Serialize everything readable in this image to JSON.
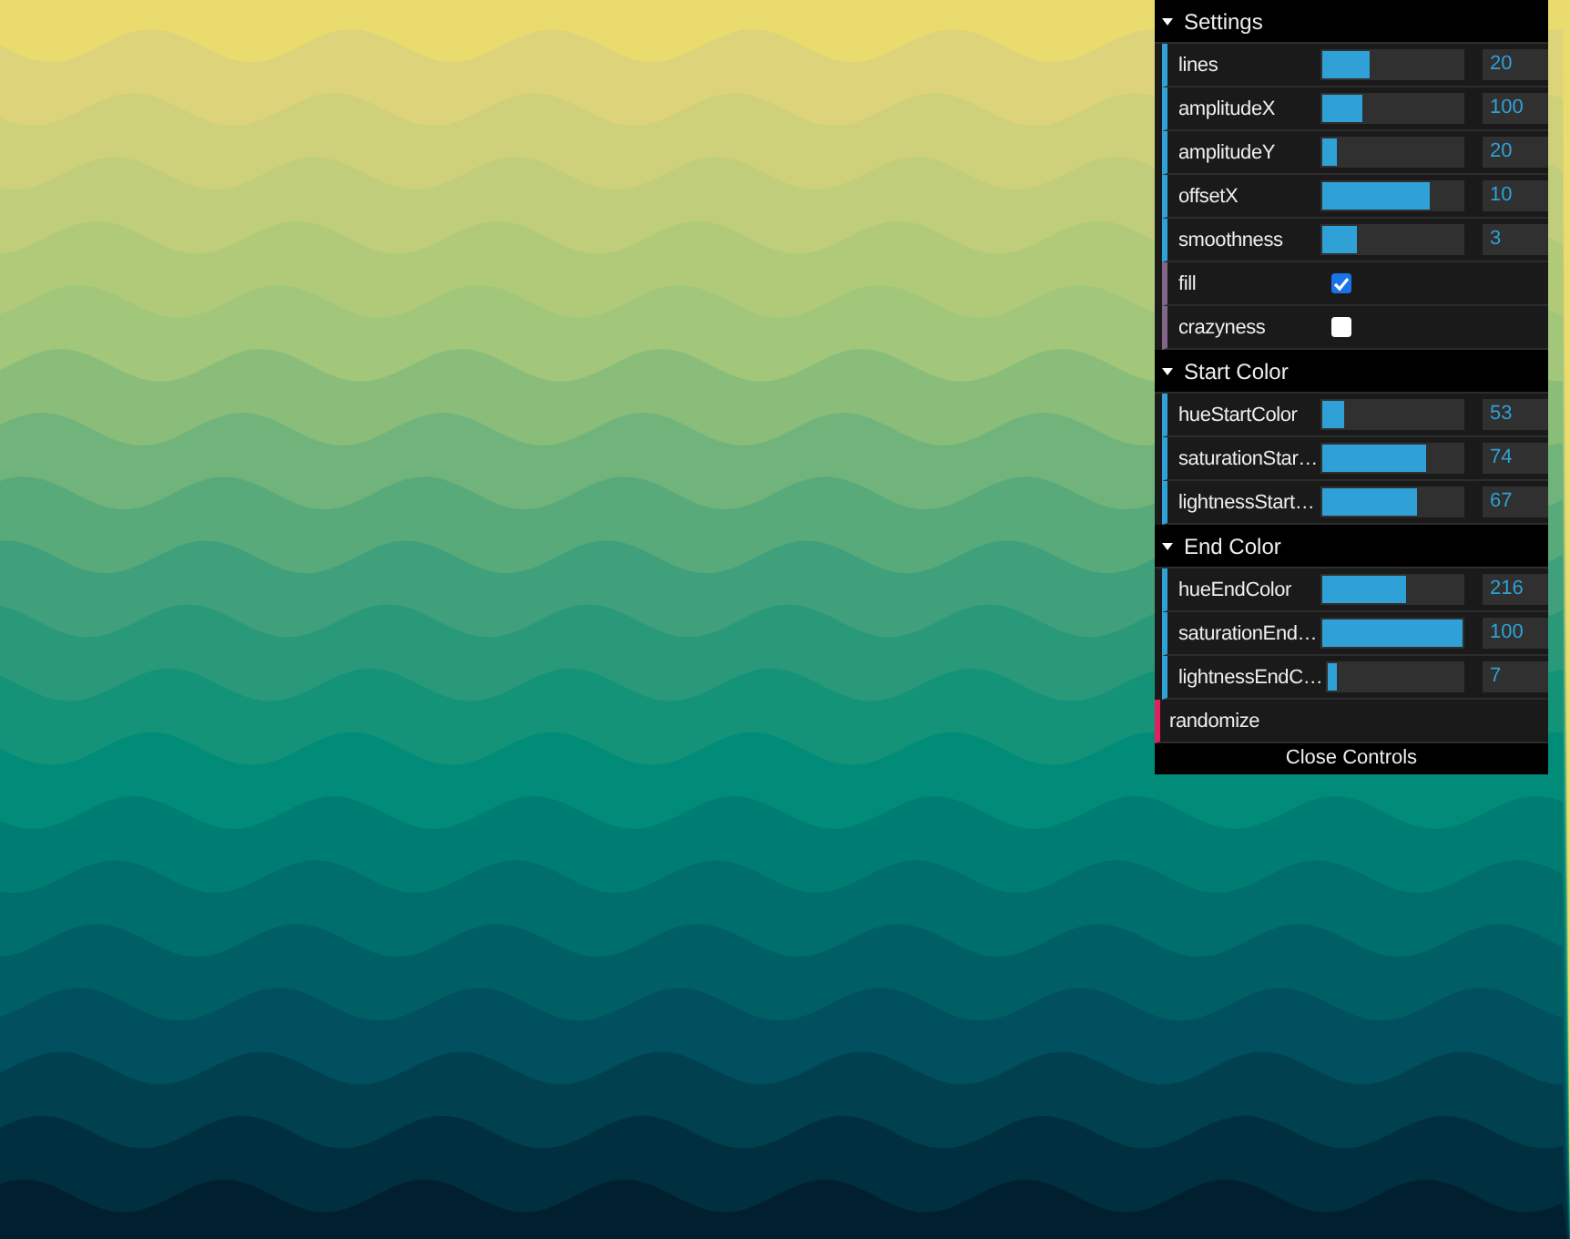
{
  "folders": [
    {
      "title": "Settings",
      "expanded": true,
      "controls": [
        {
          "kind": "number",
          "label": "lines",
          "level": 0.34,
          "value": "20"
        },
        {
          "kind": "number",
          "label": "amplitudeX",
          "level": 0.29,
          "value": "100"
        },
        {
          "kind": "number",
          "label": "amplitudeY",
          "level": 0.1,
          "value": "20"
        },
        {
          "kind": "number",
          "label": "offsetX",
          "level": 0.76,
          "value": "10"
        },
        {
          "kind": "number",
          "label": "smoothness",
          "level": 0.25,
          "value": "3"
        },
        {
          "kind": "boolean",
          "label": "fill",
          "checked": true
        },
        {
          "kind": "boolean",
          "label": "crazyness",
          "checked": false
        }
      ]
    },
    {
      "title": "Start Color",
      "expanded": true,
      "controls": [
        {
          "kind": "number",
          "label": "hueStartColor",
          "level": 0.15,
          "value": "53"
        },
        {
          "kind": "number",
          "label": "saturationStar…",
          "level": 0.74,
          "value": "74"
        },
        {
          "kind": "number",
          "label": "lightnessStart…",
          "level": 0.67,
          "value": "67"
        }
      ]
    },
    {
      "title": "End Color",
      "expanded": true,
      "controls": [
        {
          "kind": "number",
          "label": "hueEndColor",
          "level": 0.6,
          "value": "216"
        },
        {
          "kind": "number",
          "label": "saturationEnd…",
          "level": 1.0,
          "value": "100"
        },
        {
          "kind": "number",
          "label": "lightnessEndC…",
          "level": 0.07,
          "value": "7"
        }
      ]
    }
  ],
  "actions": [
    {
      "kind": "function",
      "label": "randomize"
    }
  ],
  "close_button": "Close Controls"
}
